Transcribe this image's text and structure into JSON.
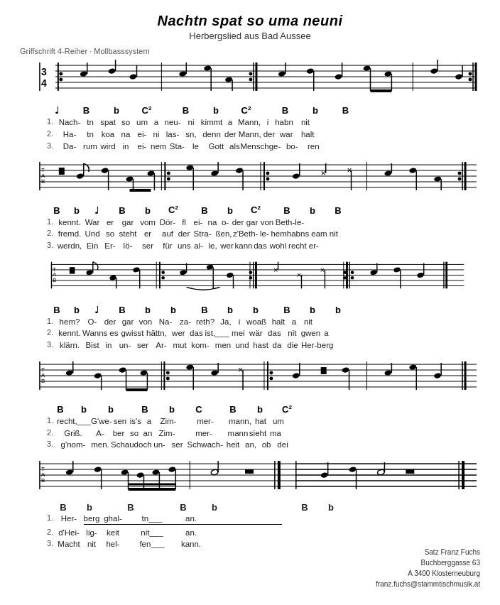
{
  "title": "Nachtn spat so uma neuni",
  "subtitle": "Herbergslied aus Bad Aussee",
  "griffschrift": "Griffschrift 4-Reiher · Mollbasssystem",
  "sections": [
    {
      "chords": [
        "B",
        "b",
        "C²",
        "",
        "B",
        "b",
        "C²",
        "",
        "B",
        "b",
        "B"
      ],
      "lyrics": [
        {
          "num": "1.",
          "words": [
            "Nach-",
            "tn",
            "spat",
            "so",
            "um",
            "a",
            "neu-",
            "ni",
            "kimmt",
            "a",
            "Mann,",
            "i",
            "habn",
            "nit"
          ]
        },
        {
          "num": "2.",
          "words": [
            "Ha-",
            "tn",
            "koa",
            "na",
            "ei-",
            "ni",
            "las-",
            "sn,",
            "denn",
            "der",
            "Mann,",
            "der",
            "war",
            "halt"
          ]
        },
        {
          "num": "3.",
          "words": [
            "Da-",
            "rum",
            "wird",
            "in",
            "ei-",
            "nem",
            "Sta-",
            "le",
            "Gott",
            "als",
            "Mensch",
            "ge-",
            "bo-",
            "ren"
          ]
        }
      ]
    },
    {
      "chords": [
        "B",
        "b",
        "♩",
        "B",
        "b",
        "C²",
        "",
        "B",
        "b",
        "C²",
        "",
        "B",
        "b",
        "B"
      ],
      "lyrics": [
        {
          "num": "1.",
          "words": [
            "kennt.",
            "War",
            "er",
            "gar",
            "vom",
            "Dör-",
            "fl",
            "ei-",
            "na",
            "o-",
            "der",
            "gar",
            "von",
            "Beth-le-"
          ]
        },
        {
          "num": "2.",
          "words": [
            "fremd.",
            "Und",
            "so",
            "steht",
            "er",
            "auf",
            "der",
            "Stra-",
            "ßen,",
            "z'Beth-",
            "le-",
            "hem",
            "habns",
            "eam nit"
          ]
        },
        {
          "num": "3.",
          "words": [
            "werdn,",
            "Ein",
            "Er-",
            "lö-",
            "ser",
            "für",
            "uns",
            "al-",
            "le,",
            "wer",
            "kann",
            "das",
            "wohl",
            "recht er-"
          ]
        }
      ]
    },
    {
      "chords": [
        "B",
        "b",
        "♩",
        "B",
        "b",
        "b",
        "",
        "B",
        "b",
        "b",
        "",
        "B",
        "b",
        "b"
      ],
      "lyrics": [
        {
          "num": "1.",
          "words": [
            "hem?",
            "O-",
            "der",
            "gar",
            "von",
            "Na-",
            "za-",
            "reth?",
            "Ja,",
            "i",
            "woaß",
            "halt",
            "a",
            "nit"
          ]
        },
        {
          "num": "2.",
          "words": [
            "kennt.",
            "Wanns",
            "es",
            "gwisst",
            "hättn,",
            "wer",
            "das",
            "ist,___",
            "mei",
            "wär",
            "das",
            "nit",
            "gwen",
            "a"
          ]
        },
        {
          "num": "3.",
          "words": [
            "klärn.",
            "Bist",
            "in",
            "un-",
            "ser",
            "Ar-",
            "mut",
            "kom-",
            "men",
            "und",
            "hast",
            "da",
            "die",
            "Her-berg"
          ]
        }
      ]
    },
    {
      "chords": [
        "B",
        "b",
        "b",
        "",
        "B",
        "b",
        "C",
        "",
        "B",
        "b",
        "C²"
      ],
      "lyrics": [
        {
          "num": "1.",
          "words": [
            "recht,___",
            "G'we-",
            "sen",
            "is's",
            "a",
            "Zim-",
            "",
            "mer-",
            "",
            "mann,",
            "hat",
            "um"
          ]
        },
        {
          "num": "2.",
          "words": [
            "Griß.",
            "A-",
            "ber",
            "so",
            "an",
            "Zim-",
            "",
            "mer-",
            "",
            "mann",
            "sieht",
            "ma"
          ]
        },
        {
          "num": "3.",
          "words": [
            "g'nom-",
            "men.",
            "Schau",
            "doch",
            "un-",
            "ser",
            "Schwach-",
            "heit",
            "an,",
            "ob",
            "dei"
          ]
        }
      ]
    },
    {
      "chords": [
        "B",
        "b",
        "B",
        "",
        "",
        "B",
        "b"
      ],
      "lyrics": [
        {
          "num": "1.",
          "words": [
            "Her-",
            "berg",
            "ghal-",
            "tn___",
            "",
            "an.",
            ""
          ]
        },
        {
          "num": "2.",
          "words": [
            "d'Hei-",
            "lig-",
            "keit",
            "nit___",
            "",
            "an.",
            ""
          ]
        },
        {
          "num": "3.",
          "words": [
            "Macht",
            "nit",
            "hel-",
            "fen___",
            "",
            "kann.",
            ""
          ]
        },
        {
          "num": "",
          "words": [
            "",
            ""
          ]
        }
      ]
    }
  ],
  "contact": {
    "line1": "Satz Franz Fuchs",
    "line2": "Buchberggasse 63",
    "line3": "A 3400 Klosterneuburg",
    "line4": "franz.fuchs@stammtischmusik.at"
  }
}
